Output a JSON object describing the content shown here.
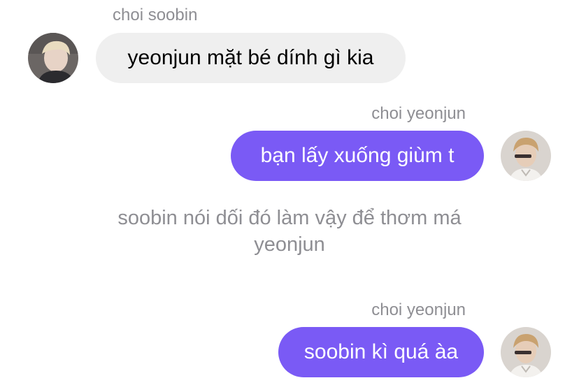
{
  "messages": [
    {
      "sender": "choi soobin",
      "text": "yeonjun mặt bé dính gì kia",
      "direction": "incoming",
      "avatar_icon": "user-avatar-soobin"
    },
    {
      "sender": "choi yeonjun",
      "text": "bạn lấy xuống giùm t",
      "direction": "outgoing",
      "avatar_icon": "user-avatar-yeonjun"
    },
    {
      "system_note": "soobin nói dối đó làm vậy để thơm má yeonjun"
    },
    {
      "sender": "choi yeonjun",
      "text": "soobin kì quá àa",
      "direction": "outgoing",
      "avatar_icon": "user-avatar-yeonjun"
    }
  ],
  "colors": {
    "outgoing_bubble": "#7a5af5",
    "incoming_bubble": "#efefef",
    "meta_text": "#8e8e93"
  }
}
